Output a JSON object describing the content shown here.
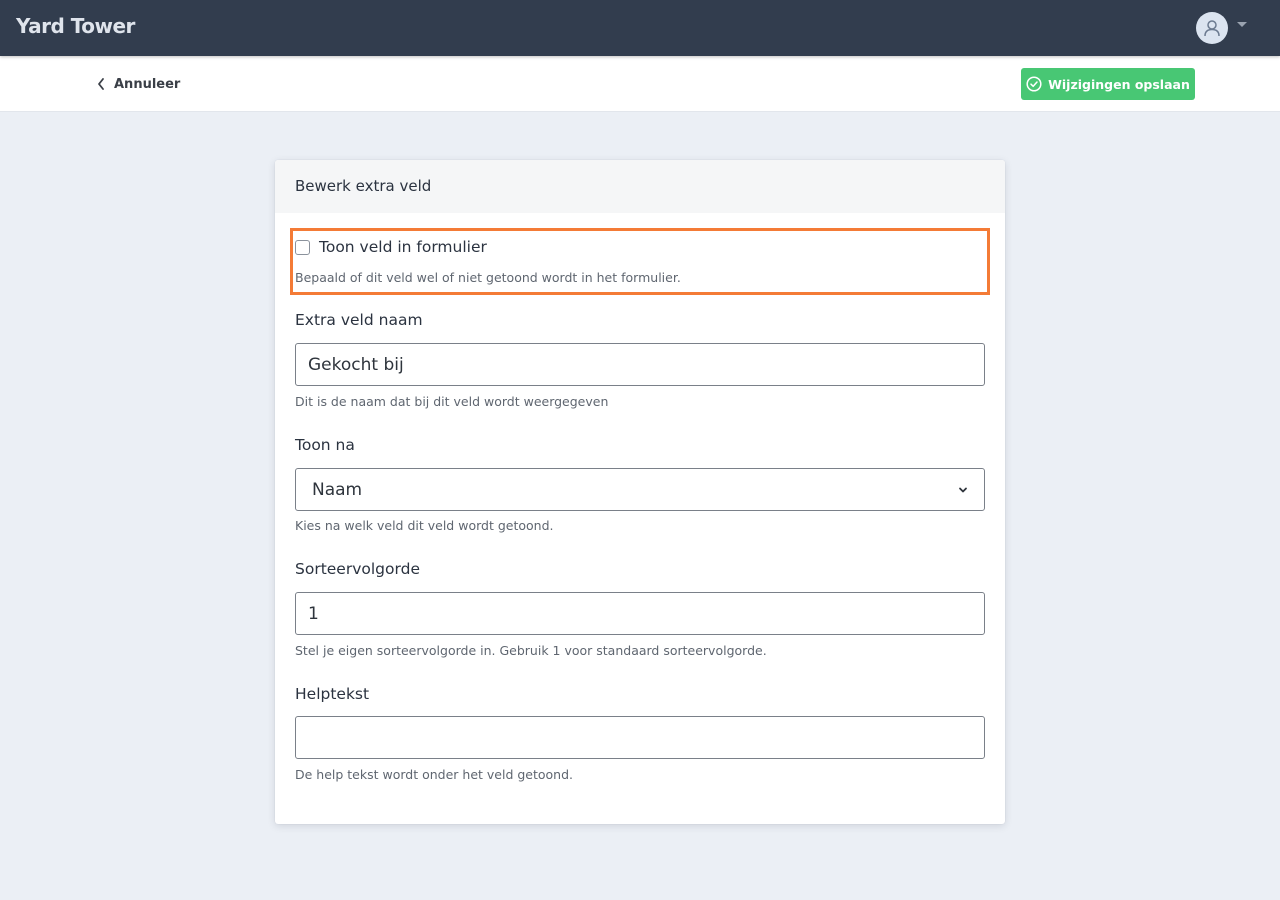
{
  "app": {
    "title": "Yard Tower"
  },
  "topbar": {
    "user_menu_icon": "user-icon",
    "dropdown_icon": "caret-down-icon"
  },
  "actionbar": {
    "cancel_label": "Annuleer",
    "cancel_icon": "chevron-left-icon",
    "save_label": "Wijzigingen opslaan",
    "save_icon": "check-circle-icon"
  },
  "colors": {
    "topbar": "#323d4e",
    "save_button": "#48c774",
    "highlight_border": "#f47b36",
    "page_background": "#ebeff5"
  },
  "form": {
    "title": "Bewerk extra veld",
    "show_field": {
      "label": "Toon veld in formulier",
      "checked": false,
      "help": "Bepaald of dit veld wel of niet getoond wordt in het formulier."
    },
    "name": {
      "label": "Extra veld naam",
      "value": "Gekocht bij",
      "help": "Dit is de naam dat bij dit veld wordt weergegeven"
    },
    "show_after": {
      "label": "Toon na",
      "selected": "Naam",
      "help": "Kies na welk veld dit veld wordt getoond."
    },
    "sort_order": {
      "label": "Sorteervolgorde",
      "value": "1",
      "help": "Stel je eigen sorteervolgorde in. Gebruik 1 voor standaard sorteervolgorde."
    },
    "help_text": {
      "label": "Helptekst",
      "value": "",
      "help": "De help tekst wordt onder het veld getoond."
    }
  }
}
